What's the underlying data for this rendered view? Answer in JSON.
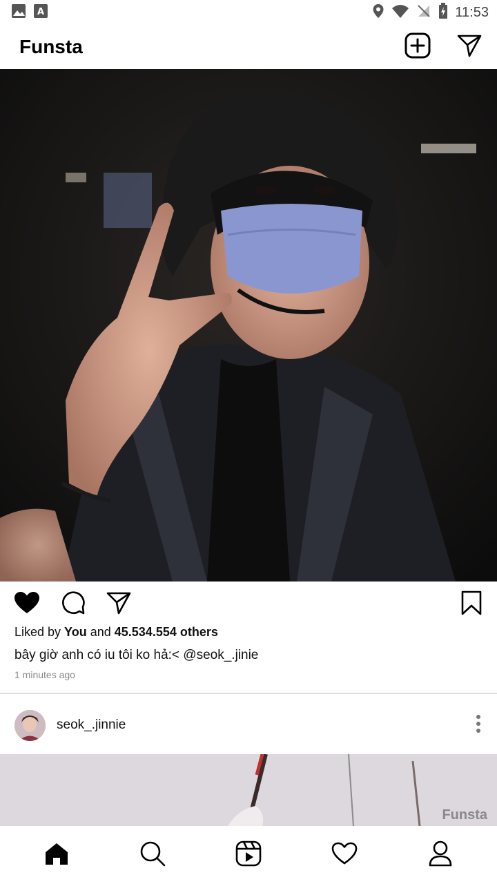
{
  "status_bar": {
    "time": "11:53",
    "left_icons": [
      "image-notification-icon",
      "font-notification-icon"
    ],
    "right_icons": [
      "location-icon",
      "wifi-icon",
      "no-sim-icon",
      "battery-charging-icon"
    ]
  },
  "header": {
    "title": "Funsta",
    "icons": [
      "add-post-icon",
      "direct-message-icon"
    ]
  },
  "post": {
    "image_icon": "post-photo",
    "actions": [
      "heart-filled-icon",
      "comment-icon",
      "share-icon",
      "bookmark-icon"
    ],
    "likes": {
      "prefix": "Liked by ",
      "user": "You",
      "middle": " and ",
      "count": "45.534.554 others"
    },
    "caption": "bây giờ anh có iu tôi ko hả:< @seok_.jinie",
    "timestamp": "1 minutes ago"
  },
  "next_post": {
    "username": "seok_.jinnie",
    "menu_icon": "more-vertical-icon",
    "watermark": "Funsta"
  },
  "bottom_nav": {
    "items": [
      "home-icon",
      "search-icon",
      "reels-icon",
      "activity-icon",
      "profile-icon"
    ]
  },
  "colors": {
    "accent": "#000000",
    "timestamp": "#8a8a8a",
    "divider": "#dddddd"
  }
}
